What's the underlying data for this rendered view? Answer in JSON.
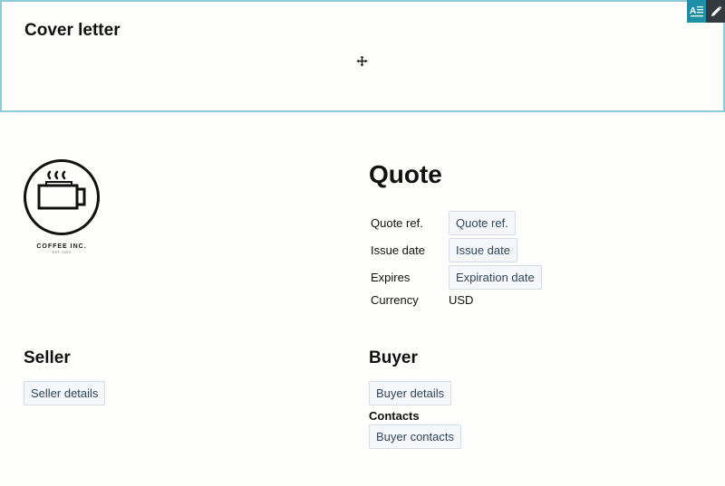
{
  "cover_letter": {
    "title": "Cover letter"
  },
  "toolbar": {
    "icons": [
      "text-format-icon",
      "pencil-icon"
    ]
  },
  "logo": {
    "name": "COFFEE INC.",
    "tagline": "EST. 2020"
  },
  "quote": {
    "title": "Quote",
    "fields": [
      {
        "label": "Quote ref.",
        "value": "Quote ref."
      },
      {
        "label": "Issue date",
        "value": "Issue date"
      },
      {
        "label": "Expires",
        "value": "Expiration date"
      },
      {
        "label": "Currency",
        "value": "USD"
      }
    ]
  },
  "seller": {
    "title": "Seller",
    "details": "Seller details"
  },
  "buyer": {
    "title": "Buyer",
    "details": "Buyer details",
    "contacts_label": "Contacts",
    "contacts": "Buyer contacts"
  },
  "colors": {
    "accent": "#1f8ea7",
    "border_highlight": "#8ccbd8",
    "chip_bg": "#f4f6f9",
    "chip_text": "#33475b"
  }
}
